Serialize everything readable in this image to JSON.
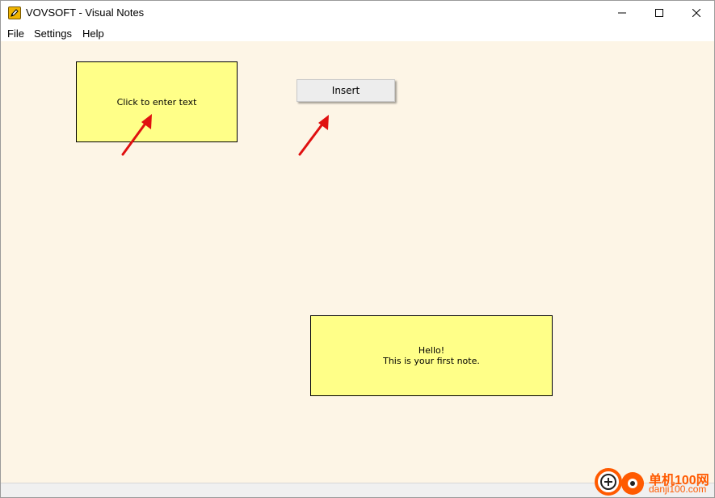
{
  "window": {
    "title": "VOVSOFT - Visual Notes"
  },
  "menu": {
    "file": "File",
    "settings": "Settings",
    "help": "Help"
  },
  "notes": [
    {
      "lines": [
        "Click to enter text"
      ]
    },
    {
      "lines": [
        "Hello!",
        "This is your first note."
      ]
    }
  ],
  "toolbar": {
    "insert_label": "Insert"
  },
  "watermark": {
    "cn_text": "单机100网",
    "domain": "danji100.com"
  },
  "colors": {
    "canvas_bg": "#fdf5e6",
    "note_bg": "#ffff88",
    "annotation_arrow": "#e01010",
    "watermark": "#ff5a00"
  }
}
